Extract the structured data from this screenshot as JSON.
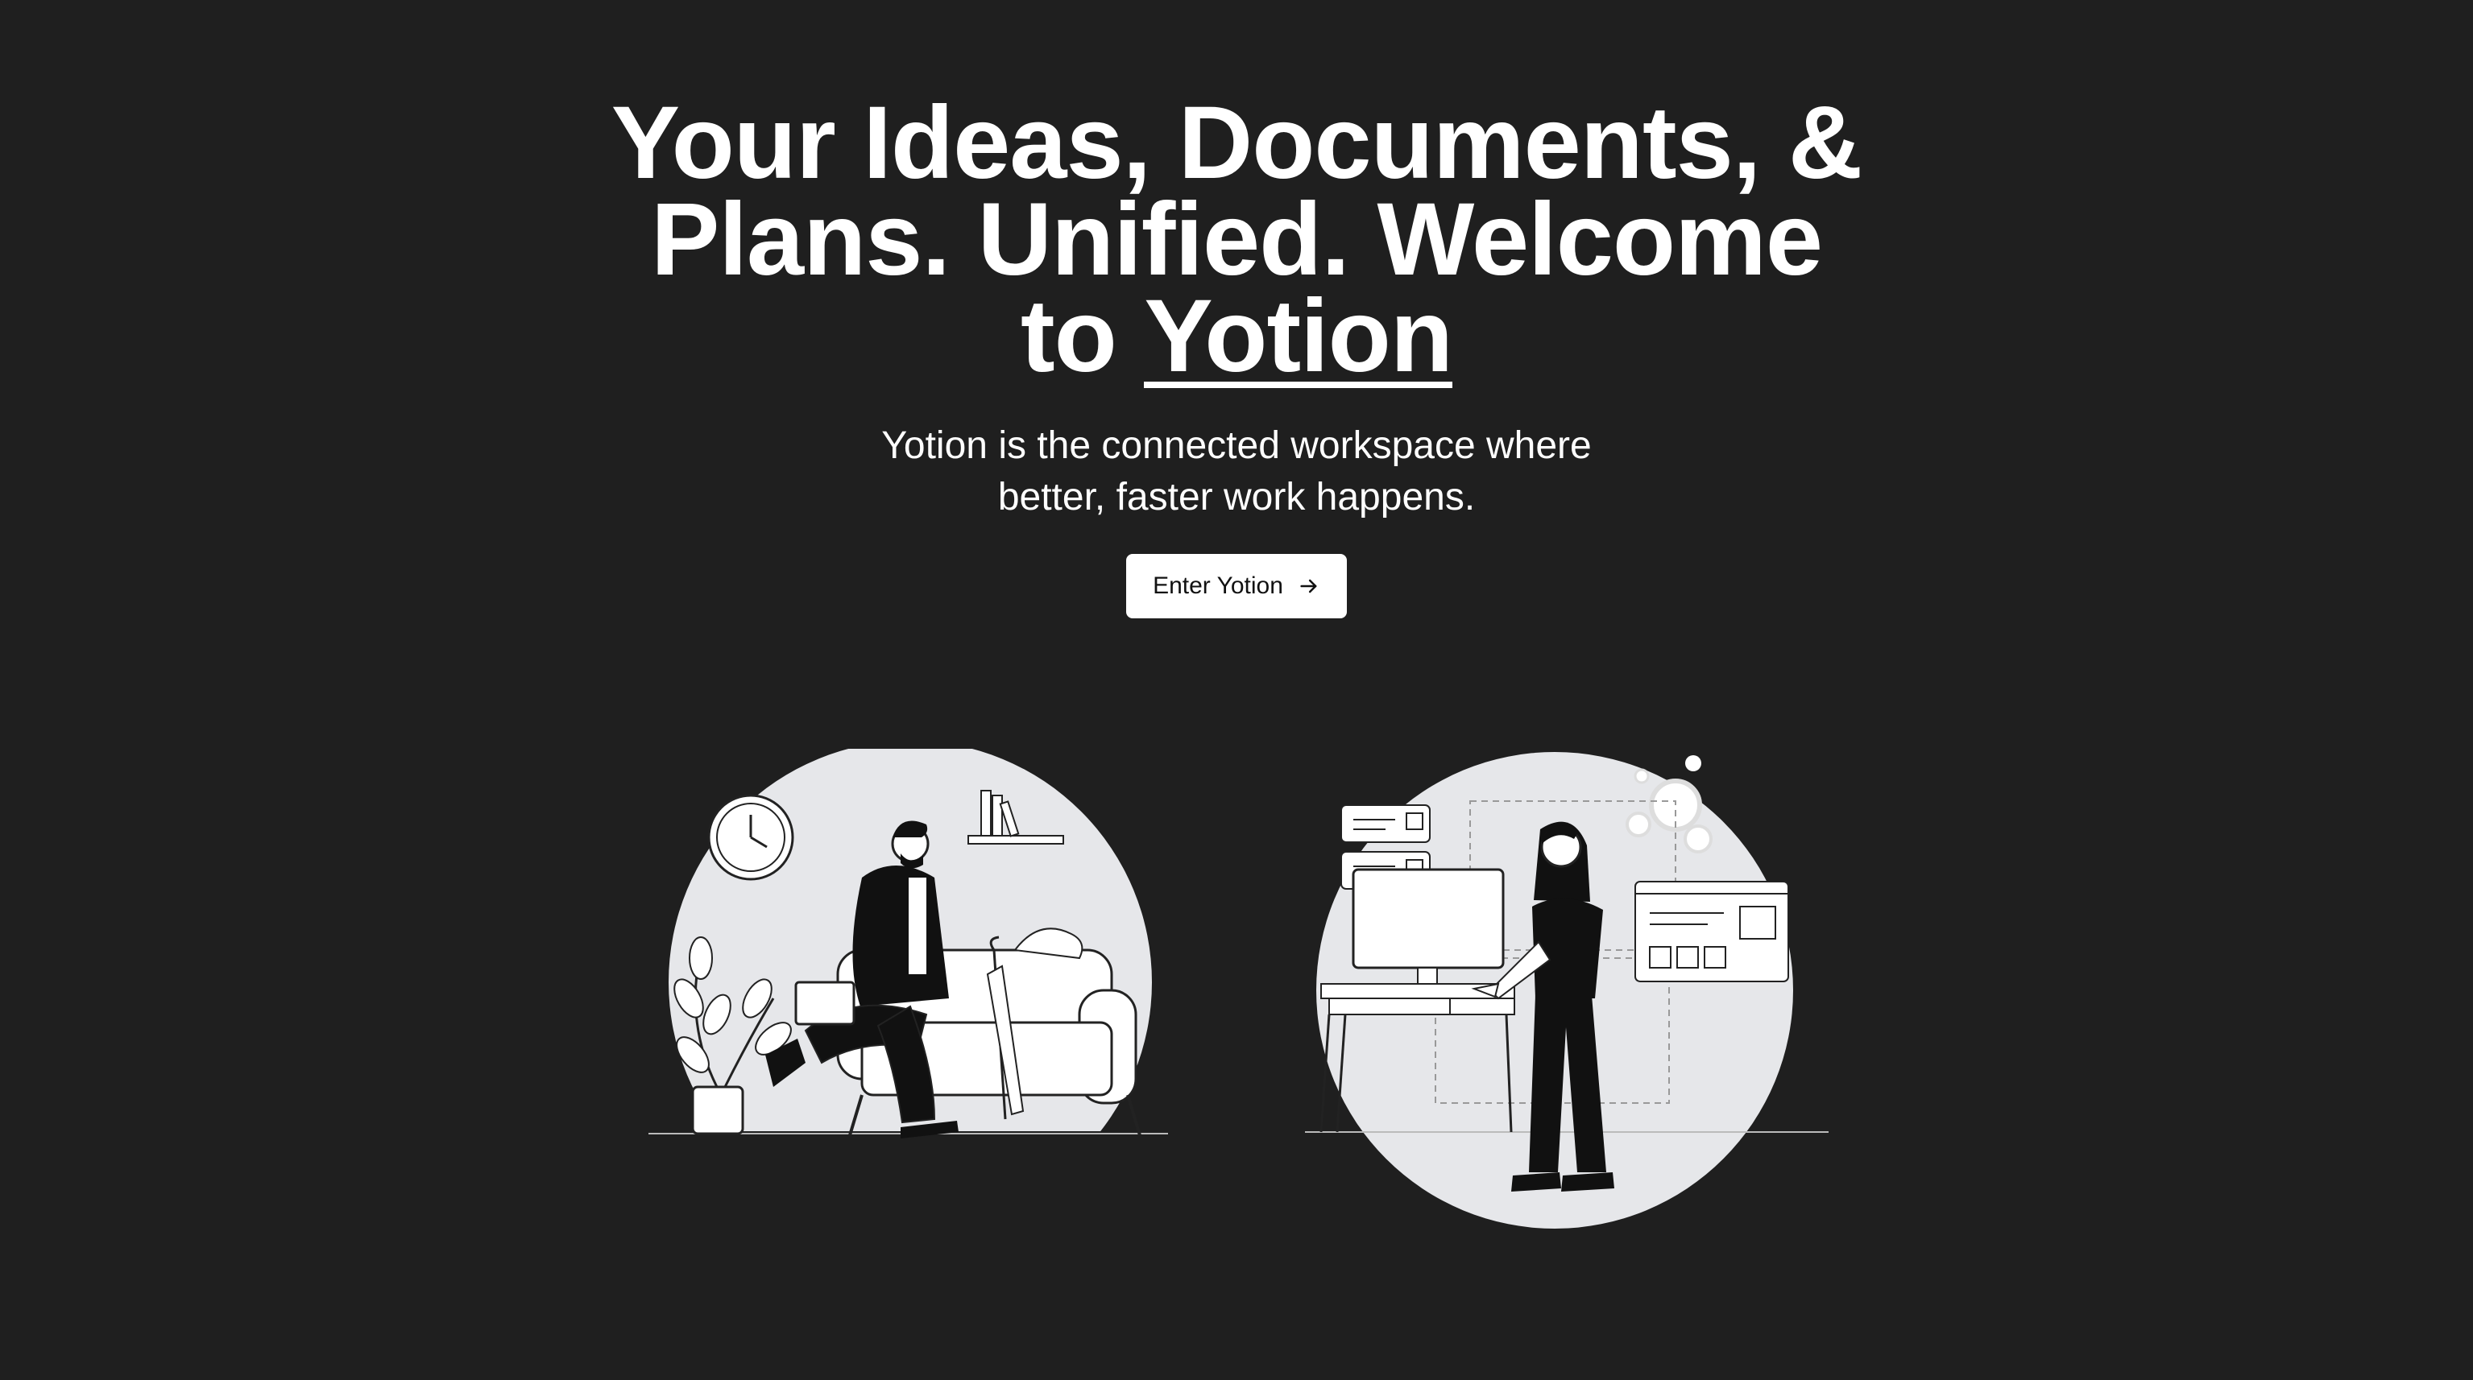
{
  "hero": {
    "headline_part1": "Your Ideas, Documents, & Plans. Unified. Welcome to",
    "headline_brand": "Yotion",
    "subhead": "Yotion is the connected workspace where better, faster work happens.",
    "cta_label": "Enter Yotion",
    "cta_icon": "arrow-right-icon"
  },
  "illustrations": {
    "left": "man-walking-illustration",
    "right": "woman-desk-illustration"
  },
  "colors": {
    "background": "#1f1f1f",
    "text": "#ffffff",
    "button_bg": "#ffffff",
    "button_text": "#111111",
    "illustration_circle": "#e6e7ea"
  }
}
